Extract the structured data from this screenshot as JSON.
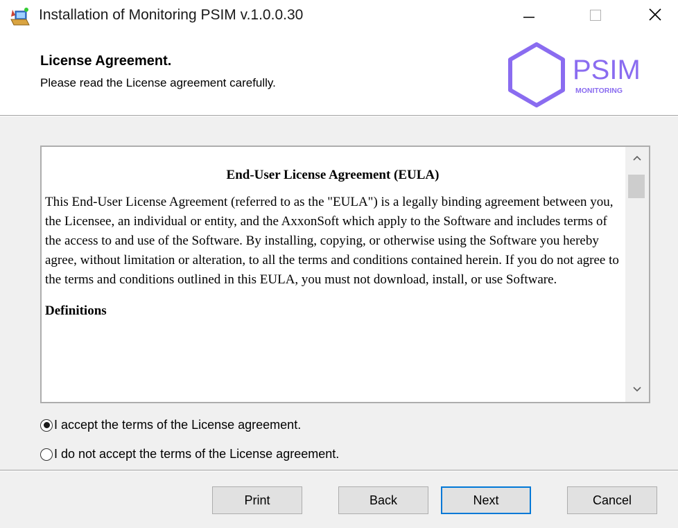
{
  "window": {
    "title": "Installation of Monitoring PSIM v.1.0.0.30",
    "icons": [
      "installer-icon",
      "minimize-icon",
      "maximize-icon",
      "close-icon"
    ]
  },
  "header": {
    "title": "License Agreement.",
    "subtitle": "Please read the License agreement carefully.",
    "logo": {
      "text": "PSIM",
      "subtext": "MONITORING",
      "color": "#8a6cf0"
    }
  },
  "eula": {
    "heading": "End-User License Agreement (EULA)",
    "paragraph": "This End-User License Agreement (referred to as the \"EULA\") is a legally binding agreement between you, the Licensee, an individual or entity, and the AxxonSoft which apply to the Software and includes terms of the access to and use of the Software. By installing, copying, or otherwise using the Software you hereby agree, without limitation or alteration, to all the terms and conditions contained herein. If you do not agree to the terms and conditions outlined in this EULA, you must not download, install, or use Software.",
    "definitions_heading": "Definitions"
  },
  "options": {
    "accept_label": "I accept the terms of the License agreement.",
    "decline_label": "I do not accept the terms of the License agreement.",
    "selected": "accept"
  },
  "buttons": {
    "print": "Print",
    "back": "Back",
    "next": "Next",
    "cancel": "Cancel"
  },
  "colors": {
    "accent": "#0078d7",
    "logo": "#8a6cf0"
  }
}
